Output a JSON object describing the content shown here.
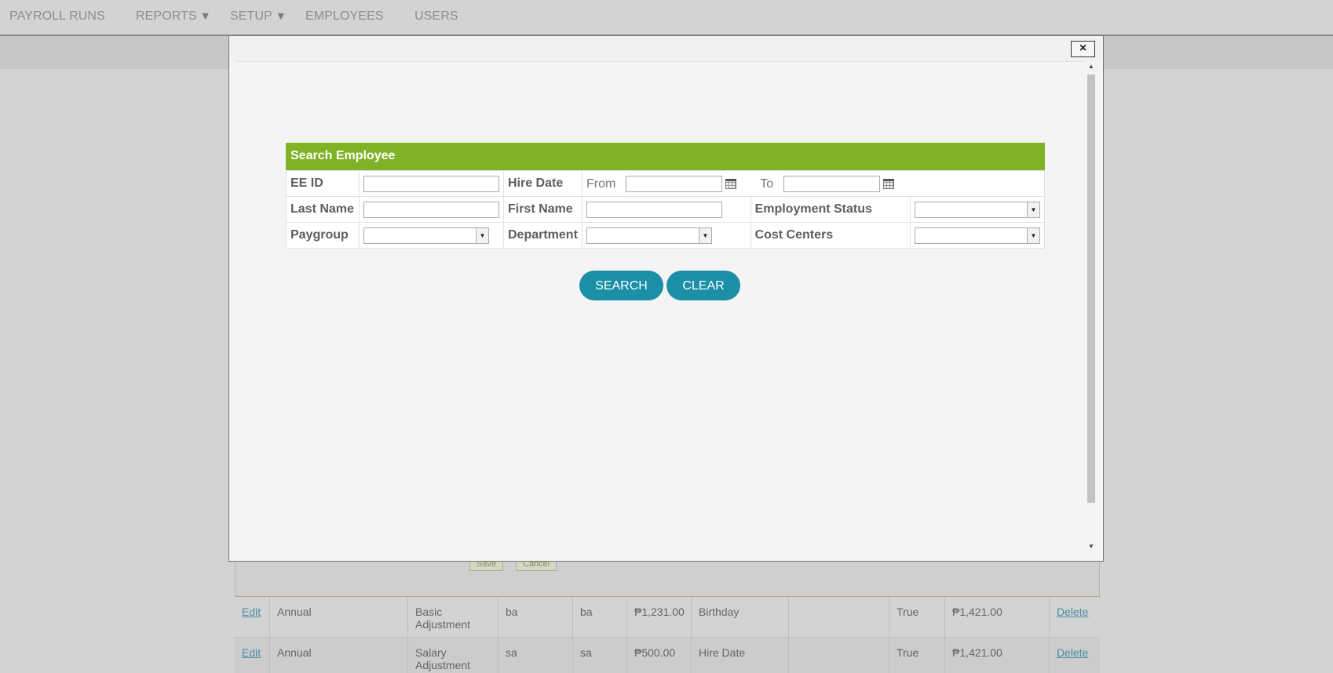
{
  "nav": {
    "items": [
      {
        "label": "PAYROLL RUNS"
      },
      {
        "label": "REPORTS",
        "dropdown": true
      },
      {
        "label": "SETUP",
        "dropdown": true
      },
      {
        "label": "EMPLOYEES"
      },
      {
        "label": "USERS"
      }
    ],
    "dropdown_arrow": "▼"
  },
  "background_table": {
    "save_label": "Save",
    "cancel_label": "Cancel",
    "rows": [
      {
        "edit": "Edit",
        "frequency": "Annual",
        "type": "Basic Adjustment",
        "code": "ba",
        "short": "ba",
        "amount": "₱1,231.00",
        "trigger": "Birthday",
        "blank": "",
        "active": "True",
        "total": "₱1,421.00",
        "delete": "Delete"
      },
      {
        "edit": "Edit",
        "frequency": "Annual",
        "type": "Salary Adjustment",
        "code": "sa",
        "short": "sa",
        "amount": "₱500.00",
        "trigger": "Hire Date",
        "blank": "",
        "active": "True",
        "total": "₱1,421.00",
        "delete": "Delete"
      }
    ]
  },
  "modal": {
    "close_label": "×",
    "scroll_up": "▲",
    "scroll_down": "▼",
    "search": {
      "title": "Search Employee",
      "ee_id_label": "EE ID",
      "ee_id_value": "",
      "hire_date_label": "Hire Date",
      "from_label": "From",
      "from_value": "",
      "to_label": "To",
      "to_value": "",
      "last_name_label": "Last Name",
      "last_name_value": "",
      "first_name_label": "First Name",
      "first_name_value": "",
      "employment_status_label": "Employment Status",
      "employment_status_value": "",
      "paygroup_label": "Paygroup",
      "paygroup_value": "",
      "department_label": "Department",
      "department_value": "",
      "cost_centers_label": "Cost Centers",
      "cost_centers_value": "",
      "search_button": "SEARCH",
      "clear_button": "CLEAR"
    }
  },
  "colors": {
    "header_green": "#80b226",
    "button_teal": "#1b8fa6",
    "overlay_gray": "#d3d3d3",
    "link": "#4a8fa3"
  },
  "icons": {
    "calendar": "calendar-icon",
    "dropdown": "chevron-down-icon",
    "close": "close-icon"
  }
}
